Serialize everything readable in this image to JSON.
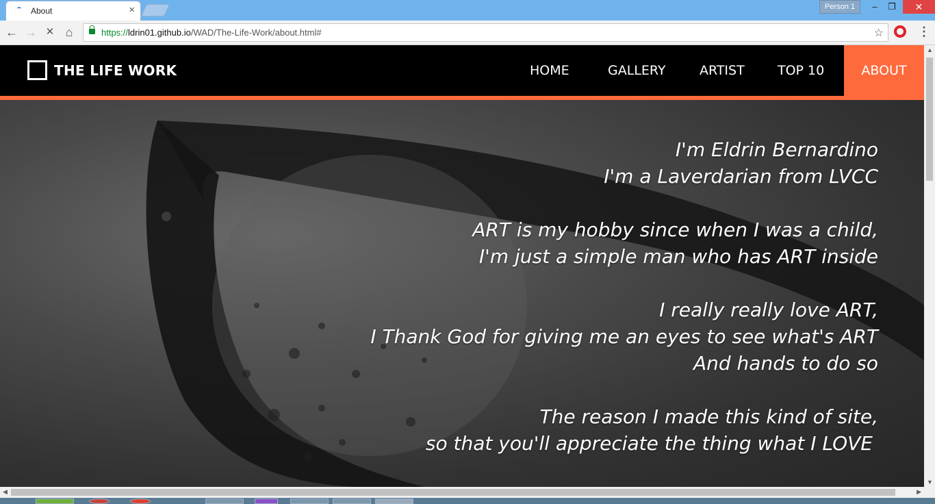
{
  "browser": {
    "tab_title": "About",
    "tab_close": "×",
    "profile_label": "Person 1",
    "window_controls": {
      "minimize": "–",
      "maximize": "❐",
      "close": "✕"
    },
    "url_scheme": "https://",
    "url_host": "ldrin01.github.io",
    "url_path": "/WAD/The-Life-Work/about.html#",
    "nav_icons": {
      "back": "arrow-left-icon",
      "forward": "arrow-right-icon",
      "stop": "close-icon",
      "home": "home-icon",
      "bookmark": "star-icon",
      "menu": "dots-vertical-icon"
    },
    "glyphs": {
      "back": "←",
      "forward": "→",
      "stop": "✕",
      "home": "⌂",
      "star": "☆",
      "menu": "⋮"
    }
  },
  "site": {
    "logo_text": "THE LIFE WORK",
    "nav": {
      "home": "HOME",
      "gallery": "GALLERY",
      "artist": "ARTIST",
      "top10": "TOP 10",
      "about": "ABOUT"
    },
    "accent_color": "#ff6a3d"
  },
  "about": {
    "line1": "I'm Eldrin Bernardino",
    "line2": "I'm a Laverdarian from LVCC",
    "line3": "ART is my hobby since when I was a child,",
    "line4": "I'm just a simple man who has ART inside",
    "line5": "I really really love ART,",
    "line6": "I Thank God for giving me an eyes to see what's ART",
    "line7": "And hands to do so",
    "line8": "The reason I made this kind of site,",
    "line9": "so that you'll appreciate the thing what I LOVE"
  }
}
